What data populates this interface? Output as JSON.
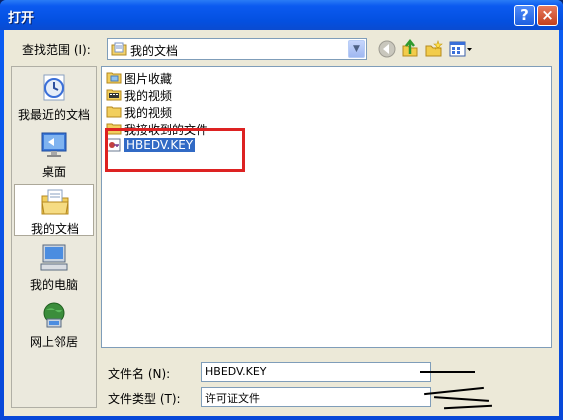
{
  "window": {
    "title": "打开",
    "help_glyph": "?",
    "close_glyph": "×"
  },
  "toolbar": {
    "lookin_label": "查找范围 (I):",
    "lookin_value": "我的文档",
    "arrow_glyph": "▼"
  },
  "places": [
    {
      "label": "我最近的文档",
      "icon": "recent-documents-icon"
    },
    {
      "label": "桌面",
      "icon": "desktop-icon"
    },
    {
      "label": "我的文档",
      "icon": "my-documents-icon",
      "selected": true
    },
    {
      "label": "我的电脑",
      "icon": "my-computer-icon"
    },
    {
      "label": "网上邻居",
      "icon": "network-places-icon"
    }
  ],
  "files": [
    {
      "name": "图片收藏",
      "icon": "pictures-folder-icon"
    },
    {
      "name": "我的视频",
      "icon": "videos-folder-icon"
    },
    {
      "name": "我的视频",
      "icon": "folder-icon"
    },
    {
      "name": "我接收到的文件",
      "icon": "folder-icon"
    },
    {
      "name": "HBEDV.KEY",
      "icon": "key-file-icon",
      "selected": true
    }
  ],
  "form": {
    "filename_label": "文件名 (N):",
    "filename_value": "HBEDV.KEY",
    "filetype_label": "文件类型 (T):",
    "filetype_value": "许可证文件"
  },
  "colors": {
    "selection": "#316ac5",
    "highlight_box": "#dd2222",
    "titlebar": "#0b5af0"
  }
}
